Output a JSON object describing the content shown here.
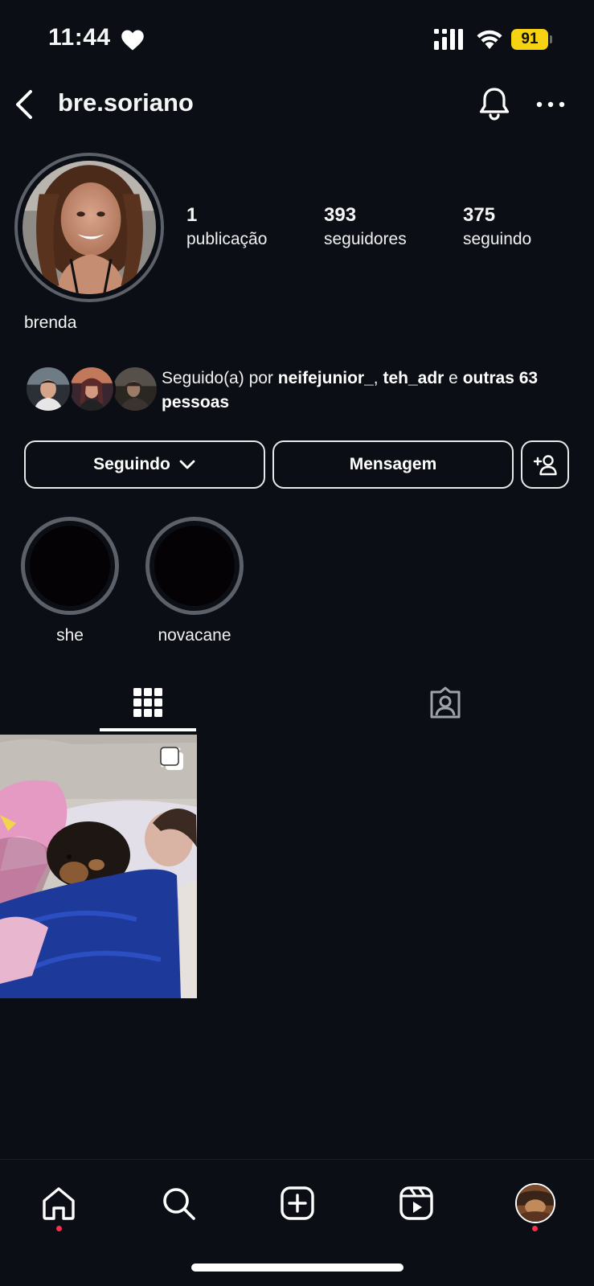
{
  "status_bar": {
    "time": "11:44",
    "battery": "91"
  },
  "header": {
    "username": "bre.soriano"
  },
  "profile": {
    "display_name": "brenda",
    "stats": [
      {
        "value": "1",
        "label": "publicação"
      },
      {
        "value": "393",
        "label": "seguidores"
      },
      {
        "value": "375",
        "label": "seguindo"
      }
    ],
    "followed_by": {
      "prefix": "Seguido(a) por ",
      "user1": "neifejunior_",
      "sep": ", ",
      "user2": "teh_adr",
      "conj": " e ",
      "others": "outras 63 pessoas"
    }
  },
  "actions": {
    "following": "Seguindo",
    "message": "Mensagem"
  },
  "highlights": [
    {
      "label": "she"
    },
    {
      "label": "novacane"
    }
  ],
  "colors": {
    "background": "#0b0e14",
    "notification_dot": "#ff2e4d",
    "battery": "#f5d312"
  }
}
